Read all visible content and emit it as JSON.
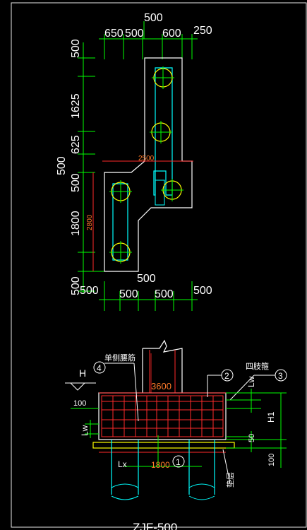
{
  "colors": {
    "background": "#000000",
    "frame": "#e8e8e8",
    "dimension_line": "#00ff00",
    "dimension_text": "#ffffff",
    "outline": "#ffffff",
    "beam": "#00ffff",
    "pile": "#ffff00",
    "pile_center": "#00ff00",
    "rebar": "#ff2a2a",
    "cap_dim": "#ff7a2a",
    "leader": "#ffffff"
  },
  "plan": {
    "top_dims": {
      "overall": "500",
      "d1": "650",
      "d2": "500",
      "d3": "600",
      "d4": "250"
    },
    "left_dims": {
      "d1": "500",
      "d2": "1625",
      "d3": "625",
      "d4": "500",
      "d5": "1800",
      "d6": "500"
    },
    "left_outer_dim": "500",
    "inner_dims": {
      "top_width": "2500",
      "bottom_height": "2800"
    },
    "bottom_dims": {
      "overall": "500",
      "left": "500",
      "d1": "500",
      "d2": "500",
      "right": "500"
    }
  },
  "section": {
    "label_h": "H",
    "label_100": "100",
    "label_lw_left": "Lw",
    "label_lw_right": "Lw",
    "label_50": "50",
    "label_h1": "H1",
    "label_100_right": "100",
    "width_dim": "3600",
    "pile_dist": "1800",
    "label_lx": "Lx",
    "callout_1": "1",
    "callout_2": "2",
    "callout_3": "3",
    "callout_4": "4",
    "note_side_rebar": "单侧腰筋",
    "note_stirrup": "四肢箍",
    "note_cushion": "垫层"
  },
  "drawing_title": "ZJF-500"
}
